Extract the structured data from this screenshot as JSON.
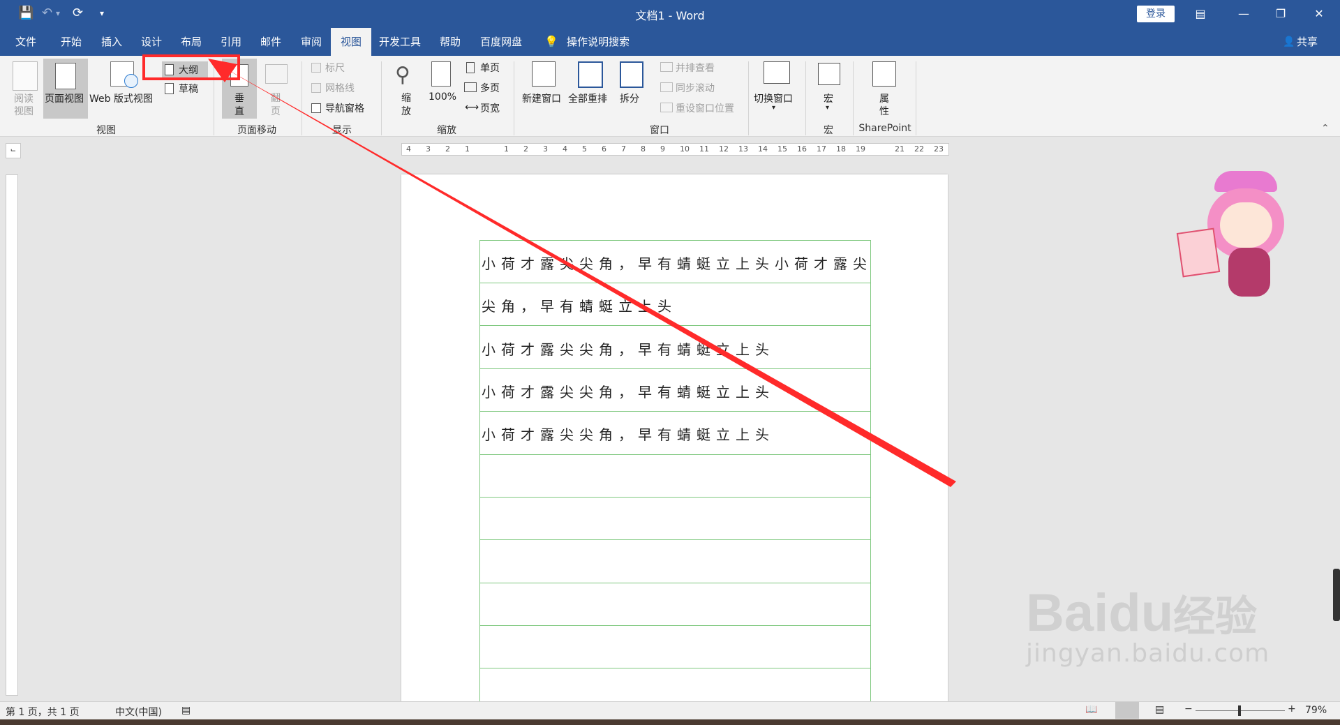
{
  "titlebar": {
    "title": "文档1 - Word",
    "login_label": "登录"
  },
  "tabs": [
    {
      "label": "文件"
    },
    {
      "label": "开始"
    },
    {
      "label": "插入"
    },
    {
      "label": "设计"
    },
    {
      "label": "布局"
    },
    {
      "label": "引用"
    },
    {
      "label": "邮件"
    },
    {
      "label": "审阅"
    },
    {
      "label": "视图"
    },
    {
      "label": "开发工具"
    },
    {
      "label": "帮助"
    },
    {
      "label": "百度网盘"
    },
    {
      "label": "操作说明搜索"
    }
  ],
  "share_label": "共享",
  "ribbon": {
    "views": {
      "read_mode": "阅读\n视图",
      "read_mode_1": "阅读",
      "read_mode_2": "视图",
      "print_layout": "页面视图",
      "web_layout": "Web 版式视图",
      "outline": "大纲",
      "draft": "草稿",
      "group": "视图"
    },
    "page_movement": {
      "vertical_1": "垂",
      "vertical_2": "直",
      "side_1": "翻",
      "side_2": "页",
      "group": "页面移动"
    },
    "show": {
      "ruler": "标尺",
      "gridlines": "网格线",
      "nav_pane": "导航窗格",
      "group": "显示"
    },
    "zoom": {
      "zoom_1": "缩",
      "zoom_2": "放",
      "hundred": "100%",
      "one_page": "单页",
      "multi_page": "多页",
      "page_width": "页宽",
      "group": "缩放"
    },
    "window": {
      "new_window": "新建窗口",
      "arrange_all": "全部重排",
      "split": "拆分",
      "side_by_side": "并排查看",
      "sync_scroll": "同步滚动",
      "reset_pos": "重设窗口位置",
      "switch_windows": "切换窗口",
      "group": "窗口"
    },
    "macros": {
      "macro": "宏",
      "group": "宏"
    },
    "sharepoint": {
      "props_1": "属",
      "props_2": "性",
      "group": "SharePoint"
    }
  },
  "ruler_h_ticks": [
    "4",
    "3",
    "2",
    "1",
    "",
    "1",
    "2",
    "3",
    "4",
    "5",
    "6",
    "7",
    "8",
    "9",
    "10",
    "11",
    "12",
    "13",
    "14",
    "15",
    "16",
    "17",
    "18",
    "19",
    "",
    "21",
    "22",
    "23"
  ],
  "document": {
    "lines": [
      "小荷才露尖尖角，早有蜻蜓立上头小荷才露尖",
      "尖角，早有蜻蜓立上头",
      "小荷才露尖尖角，早有蜻蜓立上头",
      "小荷才露尖尖角，早有蜻蜓立上头",
      "小荷才露尖尖角，早有蜻蜓立上头"
    ]
  },
  "statusbar": {
    "page_info": "第 1 页，共 1 页",
    "language": "中文(中国)",
    "zoom_level": "79%"
  },
  "watermark": {
    "logo": "Bai",
    "logo2": "du",
    "logo3": "经验",
    "url": "jingyan.baidu.com"
  },
  "colors": {
    "word_blue": "#2b579a",
    "highlight_red": "#ff2a2a",
    "grid_green": "#7ec87e"
  }
}
